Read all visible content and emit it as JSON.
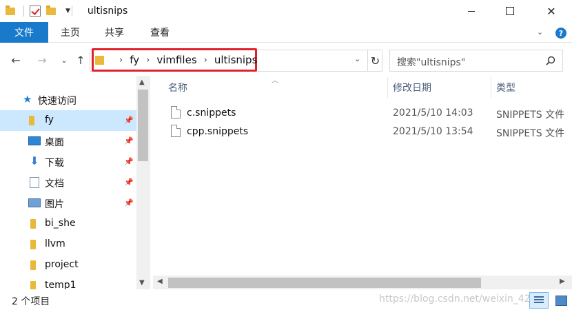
{
  "window": {
    "title": "ultisnips",
    "minimize_glyph": "",
    "maximize_glyph": "",
    "close_glyph": "✕"
  },
  "ribbon": {
    "tabs": [
      "文件",
      "主页",
      "共享",
      "查看"
    ],
    "expand_glyph": "⌄",
    "help_glyph": "?"
  },
  "nav": {
    "back_glyph": "←",
    "forward_glyph": "→",
    "recent_glyph": "⌄",
    "up_glyph": "↑",
    "refresh_glyph": "↻",
    "address_dropdown_glyph": "⌄"
  },
  "address": {
    "breadcrumbs": [
      "fy",
      "vimfiles",
      "ultisnips"
    ],
    "separator": "›",
    "highlight_color": "#e0202a"
  },
  "search": {
    "placeholder": "搜索\"ultisnips\""
  },
  "sidebar": {
    "quick_access": "快速访问",
    "items": [
      {
        "label": "fy",
        "icon": "folder-icon",
        "pinned": true
      },
      {
        "label": "桌面",
        "icon": "desktop-icon",
        "pinned": true
      },
      {
        "label": "下载",
        "icon": "download-icon",
        "pinned": true
      },
      {
        "label": "文档",
        "icon": "documents-icon",
        "pinned": true
      },
      {
        "label": "图片",
        "icon": "pictures-icon",
        "pinned": true
      },
      {
        "label": "bi_she",
        "icon": "folder-icon",
        "pinned": false
      },
      {
        "label": "llvm",
        "icon": "folder-icon",
        "pinned": false
      },
      {
        "label": "project",
        "icon": "folder-icon",
        "pinned": false
      },
      {
        "label": "temp1",
        "icon": "folder-icon",
        "pinned": false
      }
    ]
  },
  "columns": {
    "name": "名称",
    "date": "修改日期",
    "type": "类型"
  },
  "files": [
    {
      "name": "c.snippets",
      "date": "2021/5/10 14:03",
      "type": "SNIPPETS 文件"
    },
    {
      "name": "cpp.snippets",
      "date": "2021/5/10 13:54",
      "type": "SNIPPETS 文件"
    }
  ],
  "status": {
    "item_count": "2 个项目",
    "watermark": "https://blog.csdn.net/weixin_42"
  },
  "colors": {
    "accent": "#1979ca",
    "selected_bg": "#cce8ff",
    "folder": "#e8b93a"
  }
}
